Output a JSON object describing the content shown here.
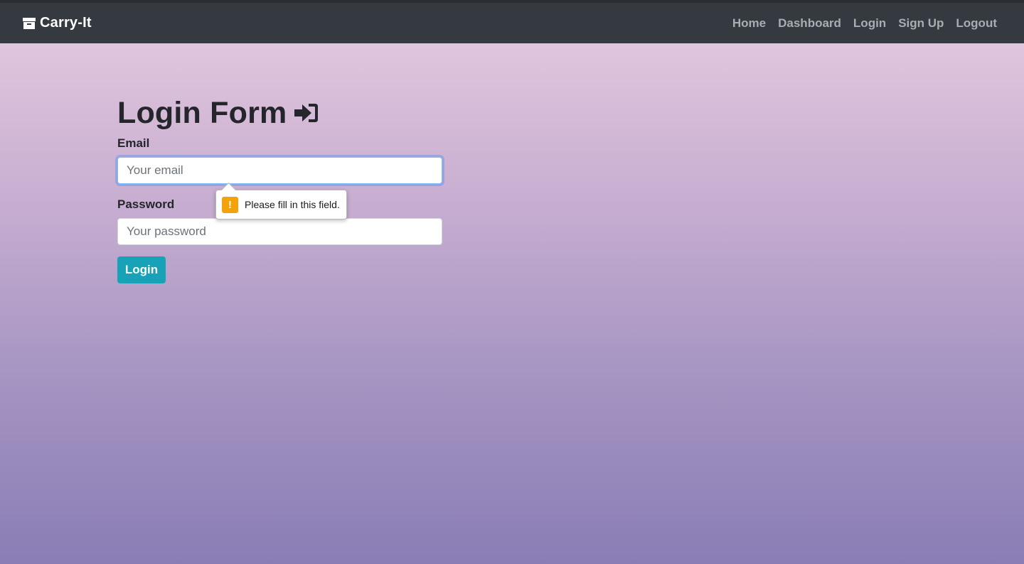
{
  "navbar": {
    "brand": "Carry-It",
    "brand_icon": "archive-icon",
    "links": [
      {
        "label": "Home"
      },
      {
        "label": "Dashboard"
      },
      {
        "label": "Login"
      },
      {
        "label": "Sign Up"
      },
      {
        "label": "Logout"
      }
    ]
  },
  "form": {
    "title": "Login Form",
    "title_icon": "sign-in-icon",
    "email_label": "Email",
    "email_placeholder": "Your email",
    "email_value": "",
    "password_label": "Password",
    "password_placeholder": "Your password",
    "password_value": "",
    "submit_label": "Login"
  },
  "validation_tooltip": {
    "icon": "warning-icon",
    "icon_glyph": "!",
    "message": "Please fill in this field."
  },
  "colors": {
    "navbar_bg": "#343a40",
    "button_bg": "#17a2b8",
    "warning": "#f4a20c",
    "gradient_top": "#e7cce0",
    "gradient_bottom": "#8a7db5"
  }
}
